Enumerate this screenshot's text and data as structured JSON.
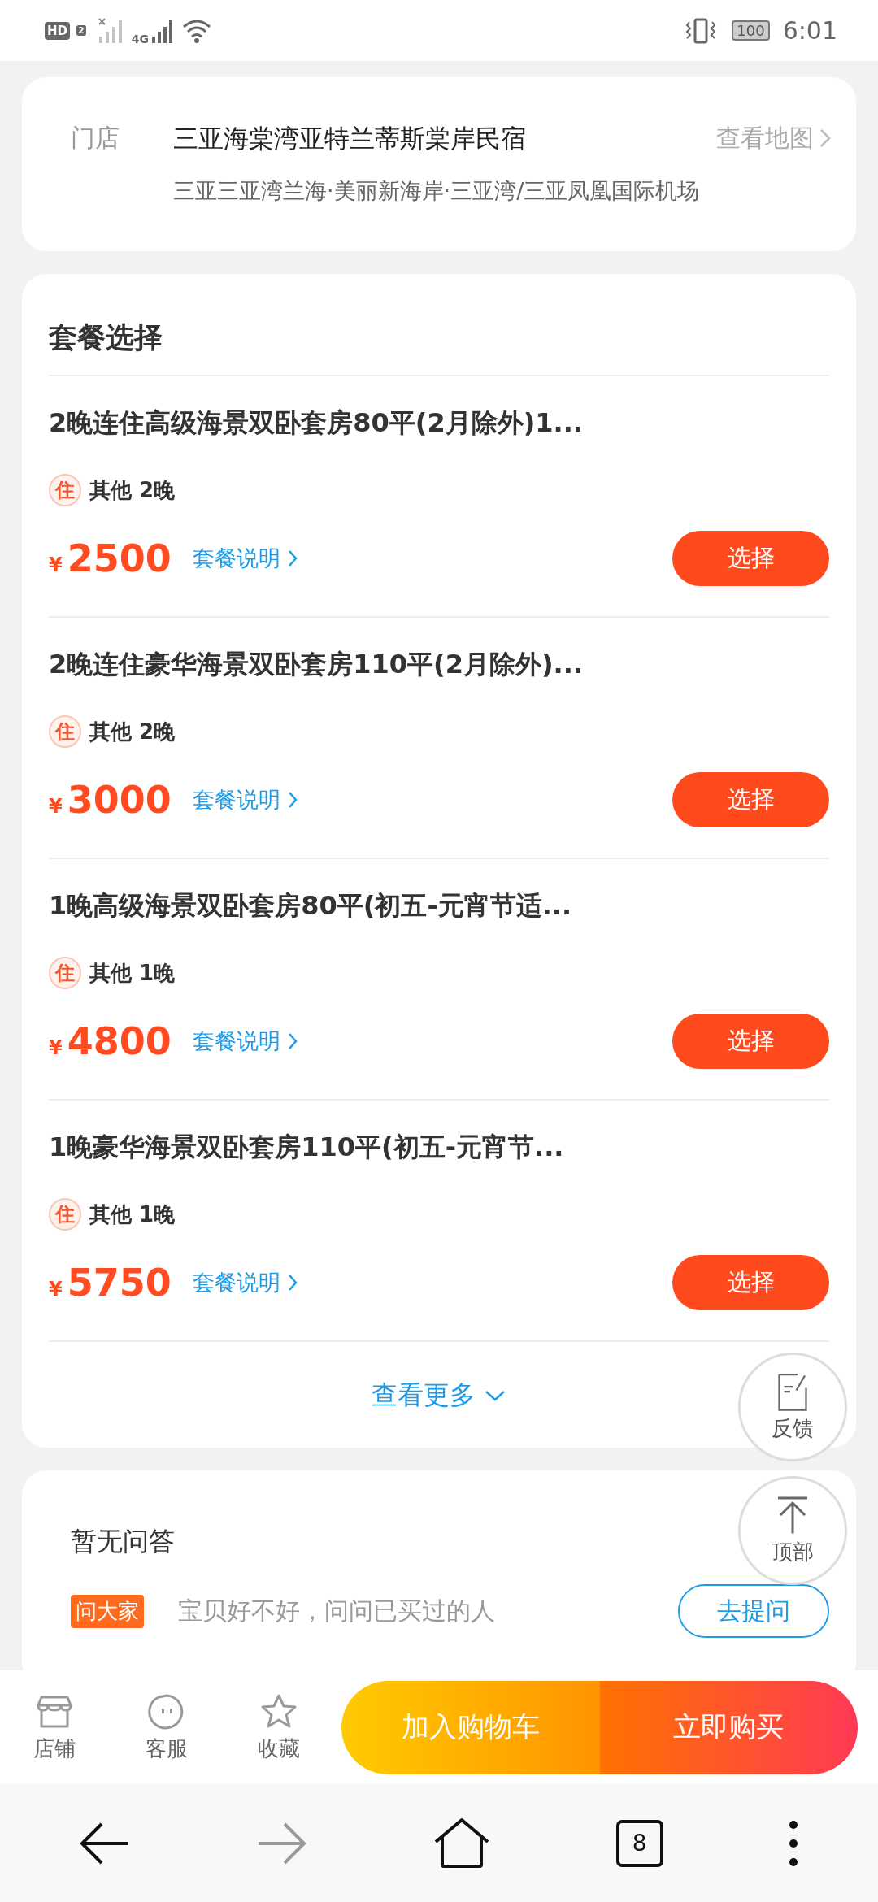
{
  "status_bar": {
    "hd": "HD",
    "sim": "2",
    "network": "4G",
    "battery": "100",
    "time": "6:01"
  },
  "store": {
    "label": "门店",
    "name": "三亚海棠湾亚特兰蒂斯棠岸民宿",
    "map_link": "查看地图",
    "address": "三亚三亚湾兰海·美丽新海岸·三亚湾/三亚凤凰国际机场"
  },
  "packages": {
    "title": "套餐选择",
    "items": [
      {
        "title": "2晚连住高级海景双卧套房80平(2月除外)1...",
        "tag": "住",
        "info": "其他 2晚",
        "currency": "¥",
        "price": "2500",
        "detail_link": "套餐说明",
        "button": "选择"
      },
      {
        "title": "2晚连住豪华海景双卧套房110平(2月除外)...",
        "tag": "住",
        "info": "其他 2晚",
        "currency": "¥",
        "price": "3000",
        "detail_link": "套餐说明",
        "button": "选择"
      },
      {
        "title": "1晚高级海景双卧套房80平(初五-元宵节适...",
        "tag": "住",
        "info": "其他 1晚",
        "currency": "¥",
        "price": "4800",
        "detail_link": "套餐说明",
        "button": "选择"
      },
      {
        "title": "1晚豪华海景双卧套房110平(初五-元宵节...",
        "tag": "住",
        "info": "其他 1晚",
        "currency": "¥",
        "price": "5750",
        "detail_link": "套餐说明",
        "button": "选择"
      }
    ],
    "more": "查看更多"
  },
  "qa": {
    "title": "暂无问答",
    "badge": "问大家",
    "prompt": "宝贝好不好，问问已买过的人",
    "button": "去提问"
  },
  "floating": [
    {
      "kind": "feedback",
      "label": "反馈"
    },
    {
      "kind": "top",
      "label": "顶部"
    }
  ],
  "action_bar": {
    "icons": [
      {
        "kind": "store",
        "label": "店铺"
      },
      {
        "kind": "service",
        "label": "客服"
      },
      {
        "kind": "favorite",
        "label": "收藏"
      }
    ],
    "add_to_cart": "加入购物车",
    "buy_now": "立即购买"
  },
  "browser_nav": {
    "tabs_count": "8",
    "forward_disabled": true
  }
}
